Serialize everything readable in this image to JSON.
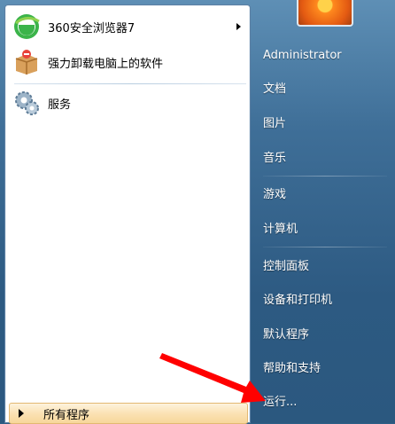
{
  "pinned_programs": [
    {
      "label": "360安全浏览器7",
      "icon": "browser-360-icon",
      "has_submenu": true
    },
    {
      "label": "强力卸载电脑上的软件",
      "icon": "uninstall-box-icon",
      "has_submenu": false
    }
  ],
  "recent_programs": [
    {
      "label": "服务",
      "icon": "services-gear-icon"
    }
  ],
  "all_programs_label": "所有程序",
  "right_pane": {
    "user_name": "Administrator",
    "items": [
      "文档",
      "图片",
      "音乐",
      "游戏",
      "计算机",
      "控制面板",
      "设备和打印机",
      "默认程序",
      "帮助和支持",
      "运行..."
    ]
  },
  "colors": {
    "annotation_arrow": "#ff0000",
    "all_programs_highlight": "#fbe2b4"
  }
}
